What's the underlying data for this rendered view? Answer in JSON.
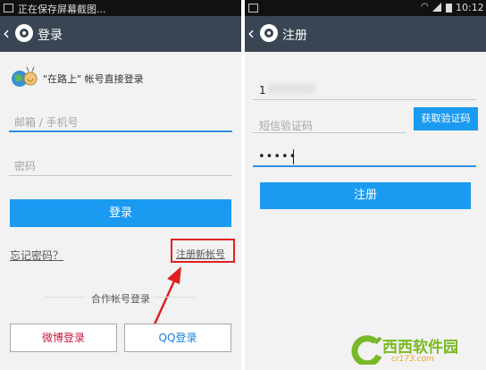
{
  "left": {
    "status_text": "正在保存屏幕截图...",
    "title": "登录",
    "brand_text": "\"在路上\" 帐号直接登录",
    "email_placeholder": "邮箱 / 手机号",
    "password_placeholder": "密码",
    "login_label": "登录",
    "forgot_label": "忘记密码？",
    "register_link": "注册新帐号",
    "partner_label": "合作帐号登录",
    "weibo_label": "微博登录",
    "qq_label": "QQ登录"
  },
  "right": {
    "time": "10:12",
    "title": "注册",
    "phone_value": "1",
    "code_placeholder": "短信验证码",
    "get_code_label": "获取验证码",
    "password_value": "•••••",
    "register_label": "注册"
  },
  "watermark": {
    "brand": "西西软件园",
    "domain": "cr173.com"
  },
  "colors": {
    "accent": "#1a9af0",
    "appbar": "#3a4553",
    "highlight": "#e02020",
    "weibo": "#c8183c",
    "qq": "#1a82d8"
  }
}
